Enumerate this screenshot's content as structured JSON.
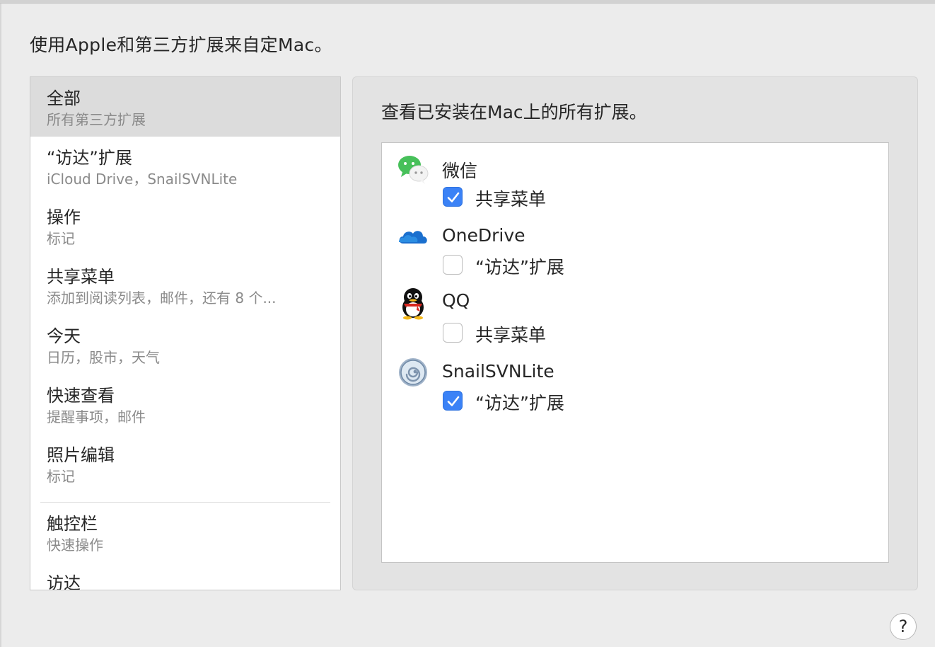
{
  "header": {
    "title": "使用Apple和第三方扩展来自定Mac。"
  },
  "sidebar": {
    "items": [
      {
        "title": "全部",
        "subtitle": "所有第三方扩展"
      },
      {
        "title": "“访达”扩展",
        "subtitle": "iCloud Drive，SnailSVNLite"
      },
      {
        "title": "操作",
        "subtitle": "标记"
      },
      {
        "title": "共享菜单",
        "subtitle": "添加到阅读列表，邮件，还有 8 个..."
      },
      {
        "title": "今天",
        "subtitle": "日历，股市，天气"
      },
      {
        "title": "快速查看",
        "subtitle": "提醒事项，邮件"
      },
      {
        "title": "照片编辑",
        "subtitle": "标记"
      },
      {
        "title": "触控栏",
        "subtitle": "快速操作"
      },
      {
        "title": "访达",
        "subtitle": ""
      }
    ]
  },
  "panel": {
    "title": "查看已安装在Mac上的所有扩展。",
    "apps": [
      {
        "name": "微信",
        "icon": "wechat-icon",
        "option": {
          "label": "共享菜单",
          "checked": true
        }
      },
      {
        "name": "OneDrive",
        "icon": "onedrive-icon",
        "option": {
          "label": "“访达”扩展",
          "checked": false
        }
      },
      {
        "name": "QQ",
        "icon": "qq-icon",
        "option": {
          "label": "共享菜单",
          "checked": false
        }
      },
      {
        "name": "SnailSVNLite",
        "icon": "snailsvn-icon",
        "option": {
          "label": "“访达”扩展",
          "checked": true
        }
      }
    ]
  },
  "help": {
    "label": "?"
  },
  "colors": {
    "accent": "#3b82f6",
    "selection": "#dcdcdc",
    "background": "#ececec"
  }
}
